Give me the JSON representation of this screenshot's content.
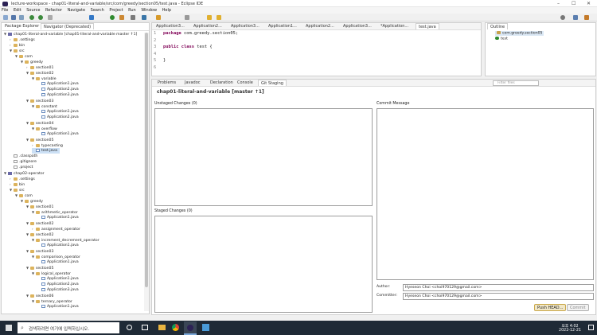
{
  "window": {
    "title": "lecture-workspace - chap01-literal-and-variable/src/com/greedy/section05/test.java - Eclipse IDE",
    "controls": [
      "–",
      "☐",
      "✕"
    ]
  },
  "menu": [
    "File",
    "Edit",
    "Source",
    "Refactor",
    "Navigate",
    "Search",
    "Project",
    "Run",
    "Window",
    "Help"
  ],
  "left_tabs": [
    "Package Explorer",
    "Navigator (Deprecated)"
  ],
  "tree": [
    {
      "label": "chap01-literal-and-variable [chap01-literal-and-variable master ↑1]",
      "depth": 0,
      "tw": "▼",
      "icon": "proj"
    },
    {
      "label": ".settings",
      "depth": 1,
      "tw": "›",
      "icon": "folder"
    },
    {
      "label": "bin",
      "depth": 1,
      "tw": "›",
      "icon": "folder"
    },
    {
      "label": "src",
      "depth": 1,
      "tw": "▼",
      "icon": "folder"
    },
    {
      "label": "com",
      "depth": 2,
      "tw": "▼",
      "icon": "folder"
    },
    {
      "label": "greedy",
      "depth": 3,
      "tw": "▼",
      "icon": "folder"
    },
    {
      "label": "section01",
      "depth": 4,
      "tw": "›",
      "icon": "folder"
    },
    {
      "label": "section02",
      "depth": 4,
      "tw": "▼",
      "icon": "folder"
    },
    {
      "label": "variable",
      "depth": 5,
      "tw": "▼",
      "icon": "folder"
    },
    {
      "label": "Application1.java",
      "depth": 6,
      "tw": "",
      "icon": "java"
    },
    {
      "label": "Application2.java",
      "depth": 6,
      "tw": "",
      "icon": "java"
    },
    {
      "label": "Application3.java",
      "depth": 6,
      "tw": "",
      "icon": "java"
    },
    {
      "label": "section03",
      "depth": 4,
      "tw": "▼",
      "icon": "folder"
    },
    {
      "label": "constant",
      "depth": 5,
      "tw": "▼",
      "icon": "folder"
    },
    {
      "label": "Application1.java",
      "depth": 6,
      "tw": "",
      "icon": "java"
    },
    {
      "label": "Application2.java",
      "depth": 6,
      "tw": "",
      "icon": "java"
    },
    {
      "label": "section04",
      "depth": 4,
      "tw": "▼",
      "icon": "folder"
    },
    {
      "label": "overflow",
      "depth": 5,
      "tw": "▼",
      "icon": "folder"
    },
    {
      "label": "Application1.java",
      "depth": 6,
      "tw": "",
      "icon": "java"
    },
    {
      "label": "section05",
      "depth": 4,
      "tw": "▼",
      "icon": "folder"
    },
    {
      "label": "typecasting",
      "depth": 5,
      "tw": "›",
      "icon": "folder"
    },
    {
      "label": "test.java",
      "depth": 5,
      "tw": "",
      "icon": "java",
      "selected": true
    },
    {
      "label": ".classpath",
      "depth": 1,
      "tw": "",
      "icon": "file"
    },
    {
      "label": ".gitignore",
      "depth": 1,
      "tw": "",
      "icon": "file"
    },
    {
      "label": ".project",
      "depth": 1,
      "tw": "",
      "icon": "file"
    },
    {
      "label": "chap02-operator",
      "depth": 0,
      "tw": "▼",
      "icon": "proj"
    },
    {
      "label": ".settings",
      "depth": 1,
      "tw": "›",
      "icon": "folder"
    },
    {
      "label": "bin",
      "depth": 1,
      "tw": "›",
      "icon": "folder"
    },
    {
      "label": "src",
      "depth": 1,
      "tw": "▼",
      "icon": "folder"
    },
    {
      "label": "com",
      "depth": 2,
      "tw": "▼",
      "icon": "folder"
    },
    {
      "label": "greedy",
      "depth": 3,
      "tw": "▼",
      "icon": "folder"
    },
    {
      "label": "section01",
      "depth": 4,
      "tw": "▼",
      "icon": "folder"
    },
    {
      "label": "arithmetic_operator",
      "depth": 5,
      "tw": "▼",
      "icon": "folder"
    },
    {
      "label": "Application1.java",
      "depth": 6,
      "tw": "",
      "icon": "java"
    },
    {
      "label": "section02",
      "depth": 4,
      "tw": "▼",
      "icon": "folder"
    },
    {
      "label": "assignment_operator",
      "depth": 5,
      "tw": "›",
      "icon": "folder"
    },
    {
      "label": "section02",
      "depth": 4,
      "tw": "▼",
      "icon": "folder"
    },
    {
      "label": "increment_decrement_operator",
      "depth": 5,
      "tw": "▼",
      "icon": "folder"
    },
    {
      "label": "Application1.java",
      "depth": 6,
      "tw": "",
      "icon": "java"
    },
    {
      "label": "section03",
      "depth": 4,
      "tw": "▼",
      "icon": "folder"
    },
    {
      "label": "comparison_operator",
      "depth": 5,
      "tw": "▼",
      "icon": "folder"
    },
    {
      "label": "Application1.java",
      "depth": 6,
      "tw": "",
      "icon": "java"
    },
    {
      "label": "section05",
      "depth": 4,
      "tw": "▼",
      "icon": "folder"
    },
    {
      "label": "logical_operator",
      "depth": 5,
      "tw": "▼",
      "icon": "folder"
    },
    {
      "label": "Application1.java",
      "depth": 6,
      "tw": "",
      "icon": "java"
    },
    {
      "label": "Application2.java",
      "depth": 6,
      "tw": "",
      "icon": "java"
    },
    {
      "label": "Application3.java",
      "depth": 6,
      "tw": "",
      "icon": "java"
    },
    {
      "label": "section06",
      "depth": 4,
      "tw": "▼",
      "icon": "folder"
    },
    {
      "label": "ternary_operator",
      "depth": 5,
      "tw": "▼",
      "icon": "folder"
    },
    {
      "label": "Application1.java",
      "depth": 6,
      "tw": "",
      "icon": "java"
    }
  ],
  "editor_tabs": [
    "Application3...",
    "Application2...",
    "Application3...",
    "Application1...",
    "Application2...",
    "Application3...",
    "*Application...",
    "test.java"
  ],
  "editor": {
    "lines": [
      {
        "n": "1",
        "parts": [
          {
            "k": "package"
          },
          {
            "t": " com.greedy.section05;"
          }
        ]
      },
      {
        "n": "2",
        "parts": []
      },
      {
        "n": "3",
        "parts": [
          {
            "k": "public class"
          },
          {
            "t": " test {"
          }
        ]
      },
      {
        "n": "4",
        "parts": []
      },
      {
        "n": "5",
        "parts": [
          {
            "t": "}"
          }
        ]
      },
      {
        "n": "6",
        "parts": []
      }
    ]
  },
  "outline": {
    "tab": "Outline",
    "items": [
      "com.greedy.section05",
      "test"
    ]
  },
  "bottom_tabs": [
    "Problems",
    "Javadoc",
    "Declaration",
    "Console",
    "Git Staging"
  ],
  "filter_placeholder": "Filter files",
  "staging": {
    "repo": "chap01-literal-and-variable [master ↑1]",
    "unstaged": "Unstaged Changes (0)",
    "staged": "Staged Changes (0)",
    "commit": "Commit Message",
    "author_label": "Author:",
    "author": "Hyeseon Choi <choi970129@gmail.com>",
    "committer_label": "Committer:",
    "committer": "Hyeseon Choi <choi970129@gmail.com>",
    "push_button": "Push HEAD...",
    "commit_button": "Commit"
  },
  "taskbar": {
    "search": "검색하려면 여기에 입력하십시오.",
    "time": "오후 4:02",
    "date": "2022-12-21"
  },
  "colors": {
    "accent": "#3478c6",
    "keyword": "#7f0055",
    "taskbar": "#1f2a36"
  }
}
